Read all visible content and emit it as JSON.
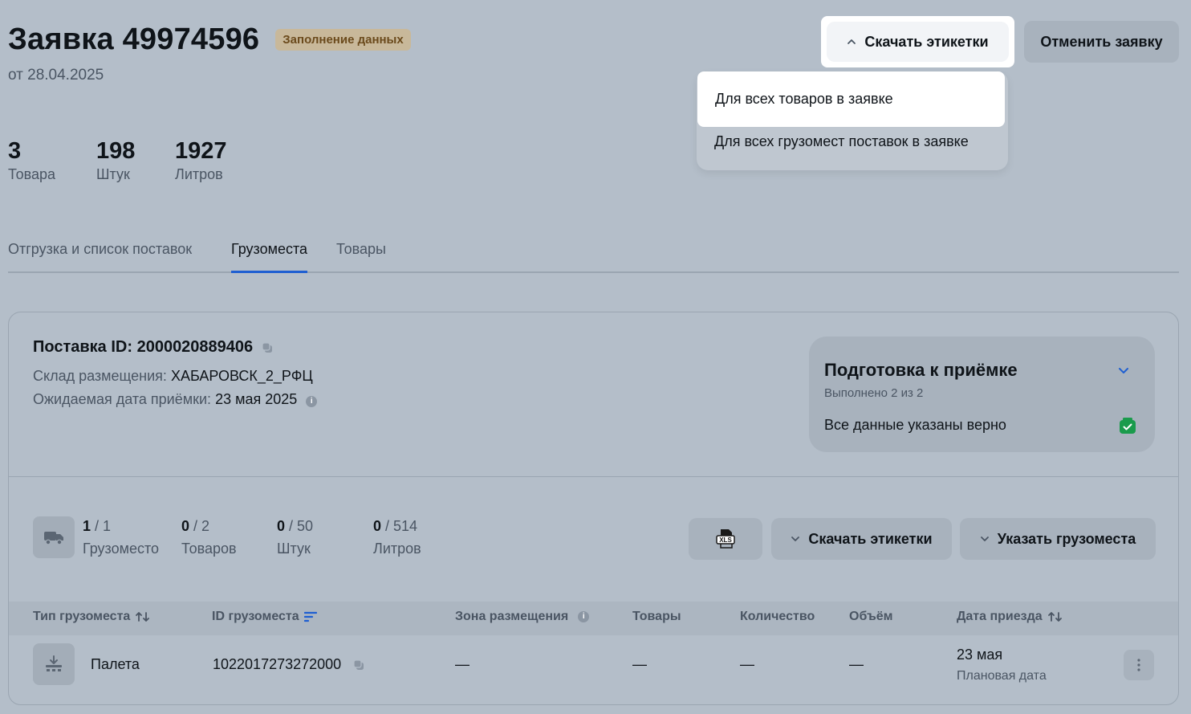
{
  "header": {
    "title": "Заявка 49974596",
    "status_badge": "Заполнение данных",
    "date": "от 28.04.2025",
    "download_labels_button": "Скачать этикетки",
    "cancel_button": "Отменить заявку"
  },
  "dropdown": {
    "items": [
      {
        "label": "Для всех товаров в заявке",
        "highlighted": true
      },
      {
        "label": "Для всех грузомест поставок в заявке",
        "highlighted": false
      }
    ]
  },
  "stats": [
    {
      "value": "3",
      "label": "Товара"
    },
    {
      "value": "198",
      "label": "Штук"
    },
    {
      "value": "1927",
      "label": "Литров"
    }
  ],
  "tabs": [
    {
      "label": "Отгрузка и список поставок",
      "active": false
    },
    {
      "label": "Грузоместа",
      "active": true
    },
    {
      "label": "Товары",
      "active": false
    }
  ],
  "supply": {
    "title": "Поставка ID: 2000020889406",
    "warehouse_label": "Склад размещения:",
    "warehouse_value": "ХАБАРОВСК_2_РФЦ",
    "expected_date_label": "Ожидаемая дата приёмки:",
    "expected_date_value": "23 мая 2025"
  },
  "prep_panel": {
    "title": "Подготовка к приёмке",
    "subtitle": "Выполнено 2 из 2",
    "line": "Все данные указаны верно"
  },
  "counters": [
    {
      "done": "1",
      "total": "/ 1",
      "label": "Грузоместо"
    },
    {
      "done": "0",
      "total": "/ 2",
      "label": "Товаров"
    },
    {
      "done": "0",
      "total": "/ 50",
      "label": "Штук"
    },
    {
      "done": "0",
      "total": "/ 514",
      "label": "Литров"
    }
  ],
  "toolbar": {
    "download_labels": "Скачать этикетки",
    "specify_cargo": "Указать грузоместа",
    "xls_icon_text": "XLS"
  },
  "table": {
    "headers": {
      "type": "Тип грузоместа",
      "id": "ID грузоместа",
      "zone": "Зона размещения",
      "goods": "Товары",
      "quantity": "Количество",
      "volume": "Объём",
      "arrival": "Дата приезда"
    },
    "rows": [
      {
        "type": "Палета",
        "id": "1022017273272000",
        "zone": "—",
        "goods": "—",
        "quantity": "—",
        "volume": "—",
        "arrival_date": "23 мая",
        "arrival_sub": "Плановая дата"
      }
    ]
  },
  "colors": {
    "accent": "#1f5fd1",
    "success": "#1a9b4c",
    "badge_bg": "#c8b89a"
  }
}
